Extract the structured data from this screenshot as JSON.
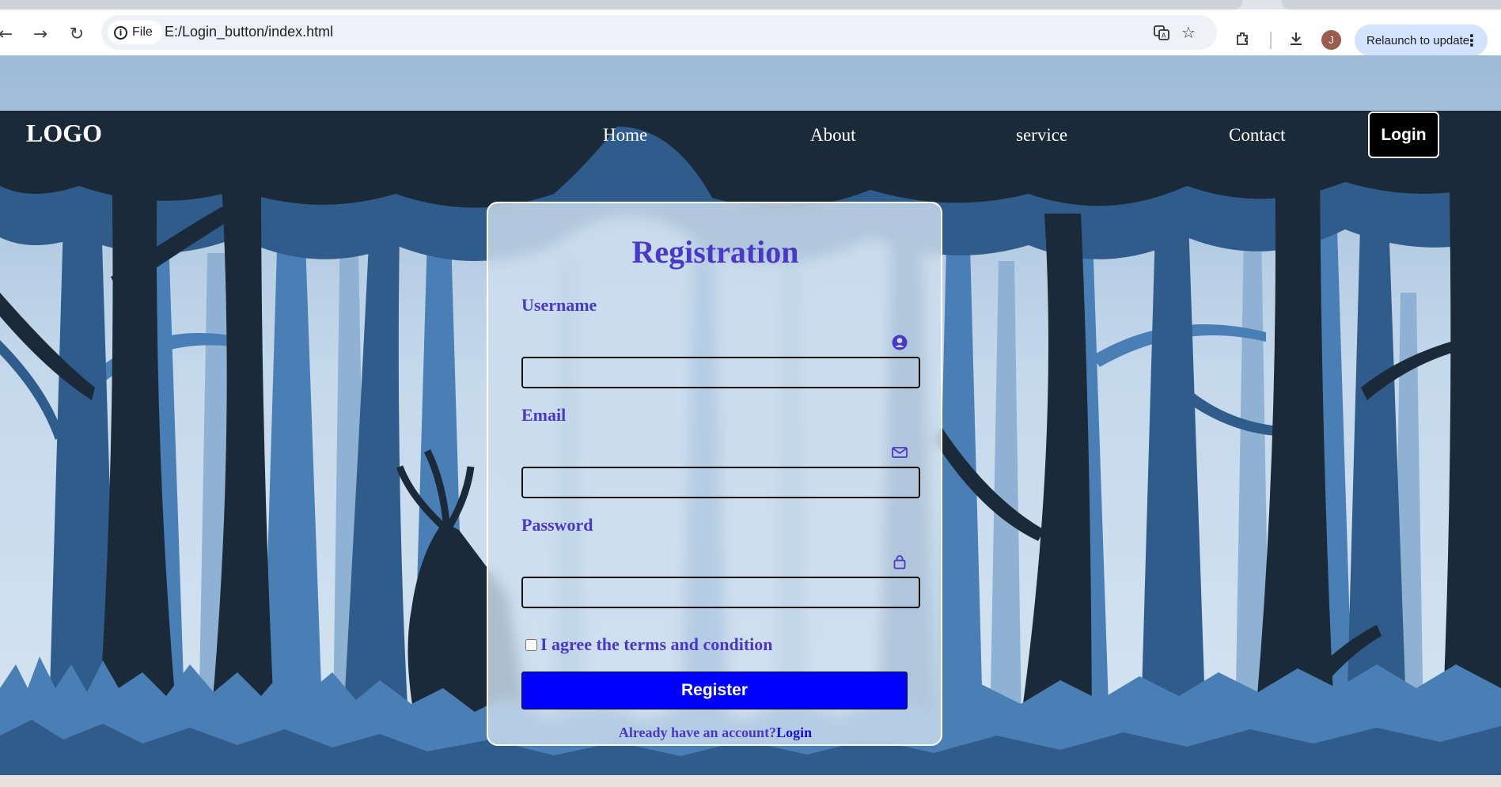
{
  "browser": {
    "chip_label": "File",
    "url": "E:/Login_button/index.html",
    "profile_initial": "J",
    "relaunch_label": "Relaunch to update"
  },
  "site": {
    "logo": "LOGO",
    "nav": [
      "Home",
      "About",
      "service",
      "Contact"
    ],
    "login_button": "Login"
  },
  "form": {
    "title": "Registration",
    "username_label": "Username",
    "email_label": "Email",
    "password_label": "Password",
    "terms_label": "I agree the terms and condition",
    "register_button": "Register",
    "already_text": "Already have an account?",
    "login_link": "Login",
    "icons": [
      "user-circle-icon",
      "envelope-icon",
      "lock-icon"
    ]
  },
  "colors": {
    "form_text": "#4a38c9",
    "register_bg": "#0000ff",
    "login_bg": "#000000",
    "forest_dark": "#1b2a38",
    "forest_sky": "#c5d9ec"
  }
}
